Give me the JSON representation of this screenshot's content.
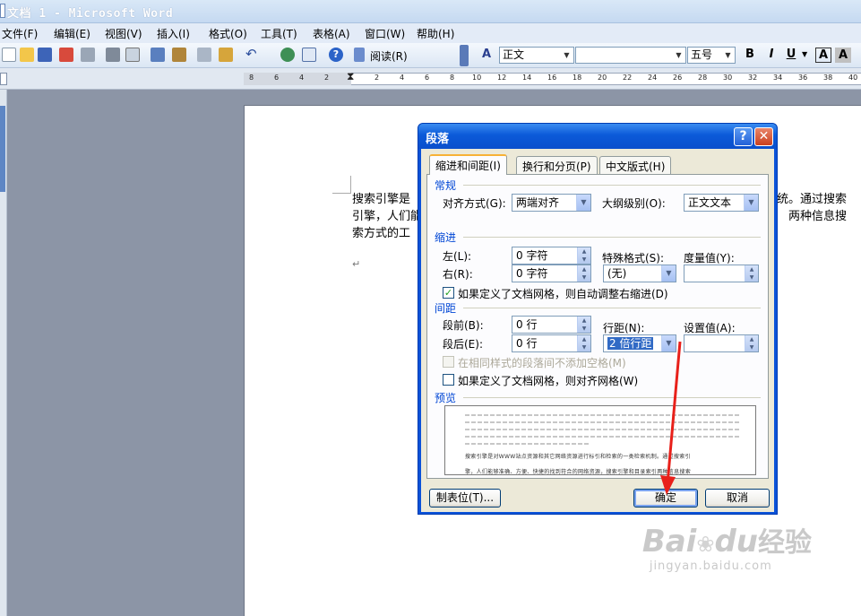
{
  "window": {
    "title": "文档 1 - Microsoft Word"
  },
  "menubar": [
    "文件(F)",
    "编辑(E)",
    "视图(V)",
    "插入(I)",
    "格式(O)",
    "工具(T)",
    "表格(A)",
    "窗口(W)",
    "帮助(H)"
  ],
  "toolbar": {
    "read_label": "阅读(R)",
    "style": "正文",
    "font": "",
    "size": "五号",
    "bold": "B",
    "italic": "I",
    "underline": "U",
    "font_color": "A",
    "char_shading": "A"
  },
  "ruler": {
    "ticks": [
      "8",
      "6",
      "4",
      "2",
      "2",
      "4",
      "6",
      "8",
      "10",
      "12",
      "14",
      "16",
      "18",
      "20",
      "22",
      "24",
      "26",
      "28",
      "30",
      "32",
      "34",
      "36",
      "38",
      "40"
    ]
  },
  "document": {
    "lines": [
      {
        "left": "搜索引擎是",
        "right": "统。通过搜索"
      },
      {
        "left": "引擎，人们能",
        "right": "两种信息搜"
      },
      {
        "left": "索方式的工",
        "right": ""
      }
    ],
    "para_mark": "↵"
  },
  "dialog": {
    "title": "段落",
    "help": "?",
    "close": "✕",
    "tabs": [
      "缩进和间距(I)",
      "换行和分页(P)",
      "中文版式(H)"
    ],
    "general": {
      "section": "常规",
      "alignment_label": "对齐方式(G):",
      "alignment_value": "两端对齐",
      "outline_label": "大纲级别(O):",
      "outline_value": "正文文本"
    },
    "indent": {
      "section": "缩进",
      "left_label": "左(L):",
      "left_value": "0 字符",
      "right_label": "右(R):",
      "right_value": "0 字符",
      "special_label": "特殊格式(S):",
      "special_value": "(无)",
      "by_label": "度量值(Y):",
      "by_value": "",
      "auto_adjust_label": "如果定义了文档网格，则自动调整右缩进(D)",
      "auto_adjust_checked": true
    },
    "spacing": {
      "section": "间距",
      "before_label": "段前(B):",
      "before_value": "0 行",
      "after_label": "段后(E):",
      "after_value": "0 行",
      "line_label": "行距(N):",
      "line_value": "2 倍行距",
      "at_label": "设置值(A):",
      "at_value": "",
      "no_space_label": "在相同样式的段落间不添加空格(M)",
      "snap_grid_label": "如果定义了文档网格，则对齐网格(W)",
      "snap_grid_checked": false
    },
    "preview": {
      "section": "预览",
      "sample_line1": "搜索引擎是对WWW站点资源和其它网络资源进行标引和检索的一类检索机制。通过搜索引",
      "sample_line2": "擎，人们能够准确、方便、快捷的找到符合的网络资源，搜索引擎和目录索引两种信息搜索"
    },
    "buttons": {
      "tabs": "制表位(T)...",
      "ok": "确定",
      "cancel": "取消"
    }
  },
  "watermark": {
    "brand": "Bai",
    "brand2": "du",
    "jingyan": "经验",
    "url": "jingyan.baidu.com"
  },
  "colors": {
    "accent": "#0a52d8",
    "arrow": "#e8201a",
    "ok_border": "#3c7fe0"
  }
}
